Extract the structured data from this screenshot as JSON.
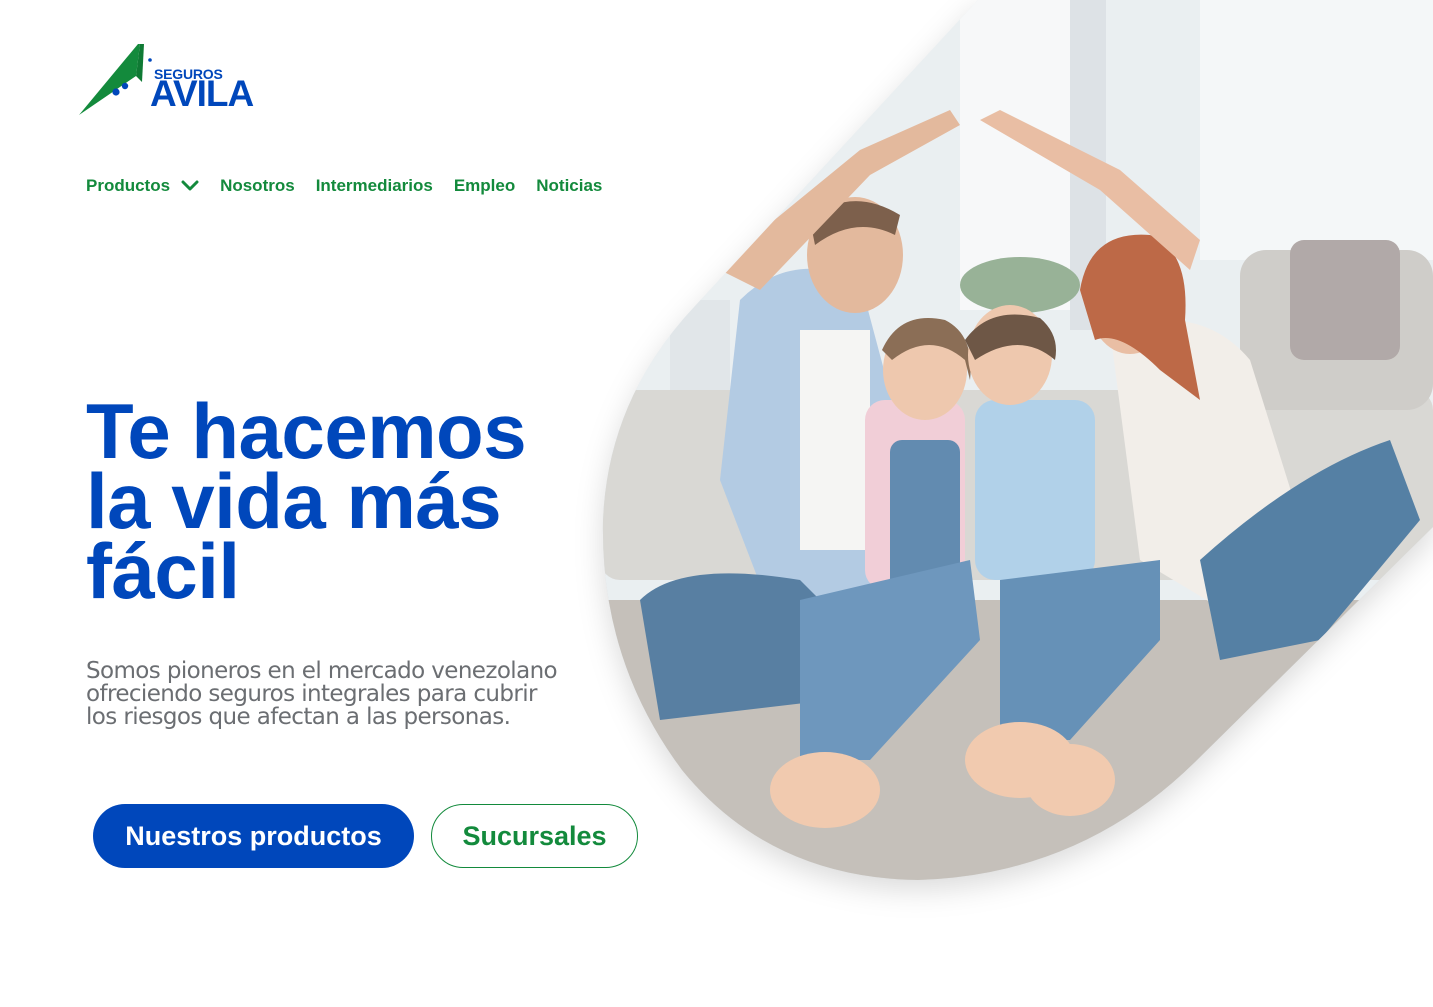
{
  "brand": {
    "name_small": "SEGUROS",
    "name_big": "AVILA",
    "colors": {
      "blue": "#0047bb",
      "green": "#138a3c"
    }
  },
  "nav": {
    "items": [
      {
        "label": "Productos",
        "has_dropdown": true,
        "icon": "chevron-down-icon"
      },
      {
        "label": "Nosotros"
      },
      {
        "label": "Intermediarios"
      },
      {
        "label": "Empleo"
      },
      {
        "label": "Noticias"
      }
    ]
  },
  "hero": {
    "headline_lines": [
      "Te hacemos",
      "la vida más",
      "fácil"
    ],
    "subtext_lines": [
      "Somos pioneros en el mercado venezolano",
      "ofreciendo seguros integrales para cubrir",
      "los riesgos que afectan a las personas."
    ],
    "primary_button": "Nuestros productos",
    "secondary_button": "Sucursales",
    "image": "family-photo"
  }
}
